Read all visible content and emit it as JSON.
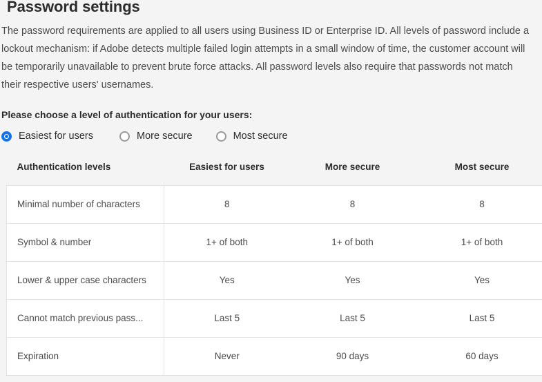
{
  "page": {
    "title": "Password settings",
    "intro": "The password requirements are applied to all users using Business ID or Enterprise ID. All levels of password include a lockout mechanism: if Adobe detects multiple failed login attempts in a small window of time, the customer account will be temporarily unavailable to prevent brute force attacks. All password levels also require that passwords not match their respective users' usernames.",
    "background_color": "#f4f4f4",
    "text_color": "#4b4b4b",
    "accent_color": "#1473e6"
  },
  "choice": {
    "prompt": "Please choose a level of authentication for your users:",
    "options": [
      {
        "label": "Easiest for users",
        "selected": true
      },
      {
        "label": "More secure",
        "selected": false
      },
      {
        "label": "Most secure",
        "selected": false
      }
    ]
  },
  "table": {
    "headers": [
      "Authentication levels",
      "Easiest for users",
      "More secure",
      "Most secure"
    ],
    "rows": [
      {
        "label": "Minimal number of characters",
        "values": [
          "8",
          "8",
          "8"
        ]
      },
      {
        "label": "Symbol & number",
        "values": [
          "1+ of both",
          "1+ of both",
          "1+ of both"
        ]
      },
      {
        "label": "Lower & upper case characters",
        "values": [
          "Yes",
          "Yes",
          "Yes"
        ]
      },
      {
        "label": "Cannot match previous pass...",
        "values": [
          "Last 5",
          "Last 5",
          "Last 5"
        ]
      },
      {
        "label": "Expiration",
        "values": [
          "Never",
          "90 days",
          "60 days"
        ]
      }
    ]
  }
}
